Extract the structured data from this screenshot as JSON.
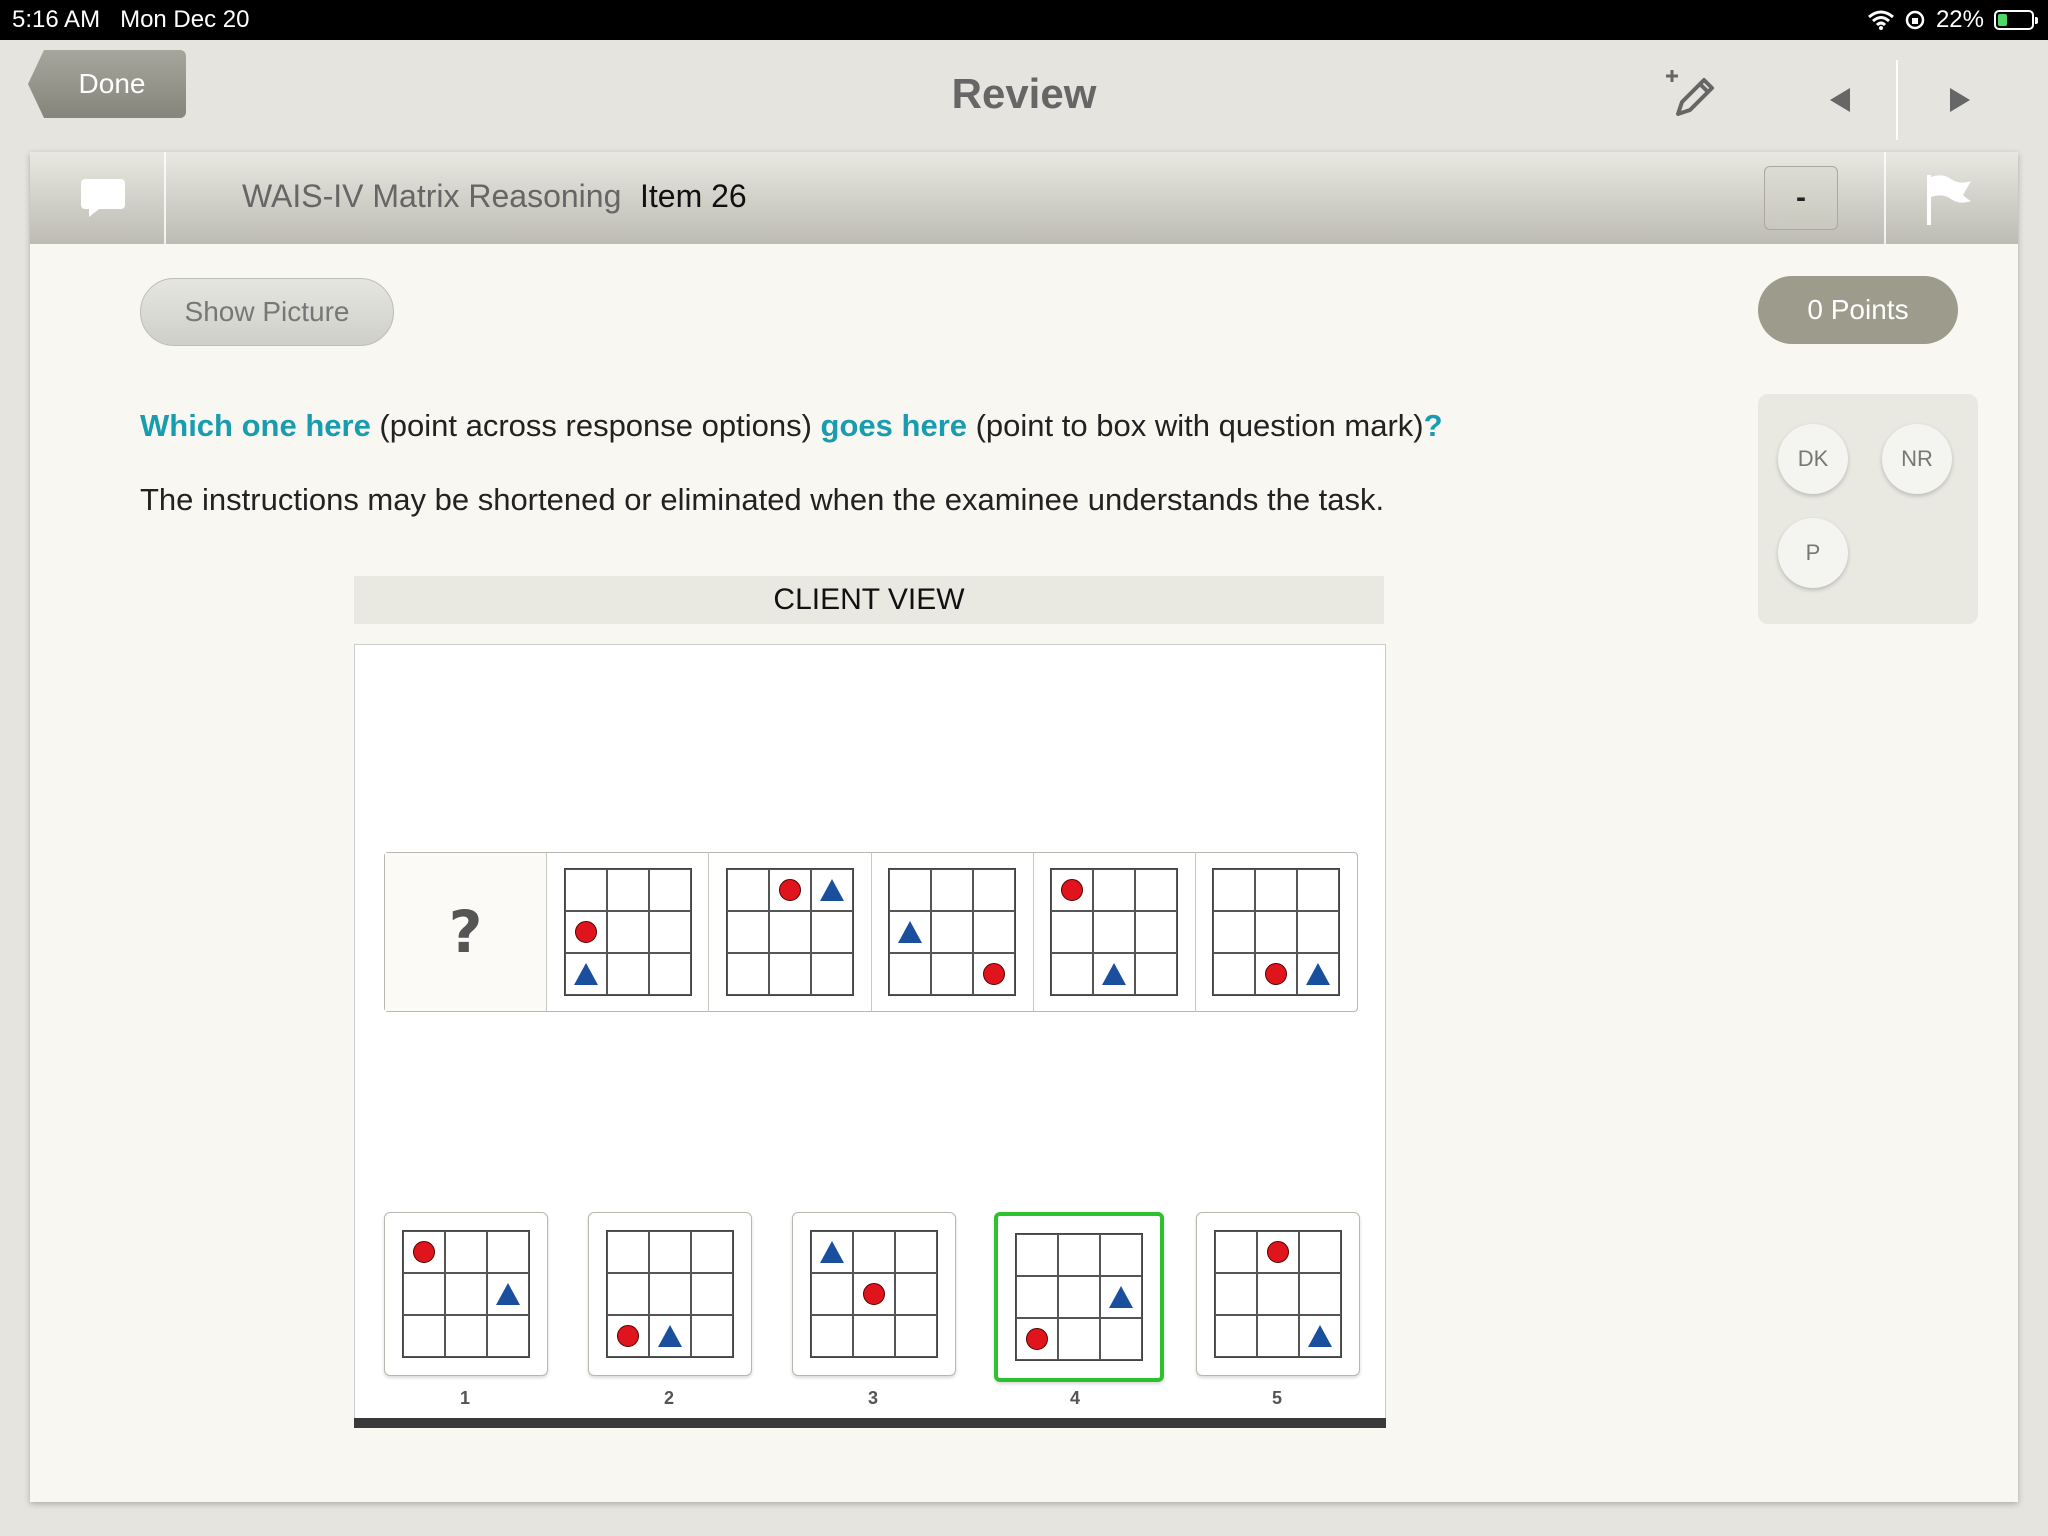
{
  "status": {
    "time": "5:16 AM",
    "date": "Mon Dec 20",
    "battery": "22%"
  },
  "nav": {
    "done_label": "Done",
    "title": "Review"
  },
  "item": {
    "test_name": "WAIS-IV Matrix Reasoning",
    "item_label": "Item 26",
    "score_value": "-"
  },
  "controls": {
    "show_picture": "Show Picture",
    "points": "0 Points"
  },
  "instructions": {
    "part1": "Which one here",
    "part2": " (point across response options) ",
    "part3": "goes here",
    "part4": " (point to box with question mark)",
    "part5": "?",
    "note": "The instructions may be shortened or eliminated when the examinee understands the task."
  },
  "response_codes": [
    "DK",
    "NR",
    "P"
  ],
  "client_view": {
    "header": "CLIENT VIEW",
    "question_mark": "?",
    "matrix": [
      {
        "dot": 3,
        "tri": 6
      },
      {
        "dot": 1,
        "tri": 2
      },
      {
        "dot": 8,
        "tri": 3
      },
      {
        "dot": 0,
        "tri": 7
      },
      {
        "dot": 7,
        "tri": 8
      }
    ],
    "options": [
      {
        "label": "1",
        "dot": 0,
        "tri": 5,
        "selected": false
      },
      {
        "label": "2",
        "dot": 6,
        "tri": 7,
        "selected": false
      },
      {
        "label": "3",
        "dot": 4,
        "tri": 0,
        "selected": false
      },
      {
        "label": "4",
        "dot": 6,
        "tri": 5,
        "selected": true
      },
      {
        "label": "5",
        "dot": 1,
        "tri": 8,
        "selected": false
      }
    ]
  }
}
